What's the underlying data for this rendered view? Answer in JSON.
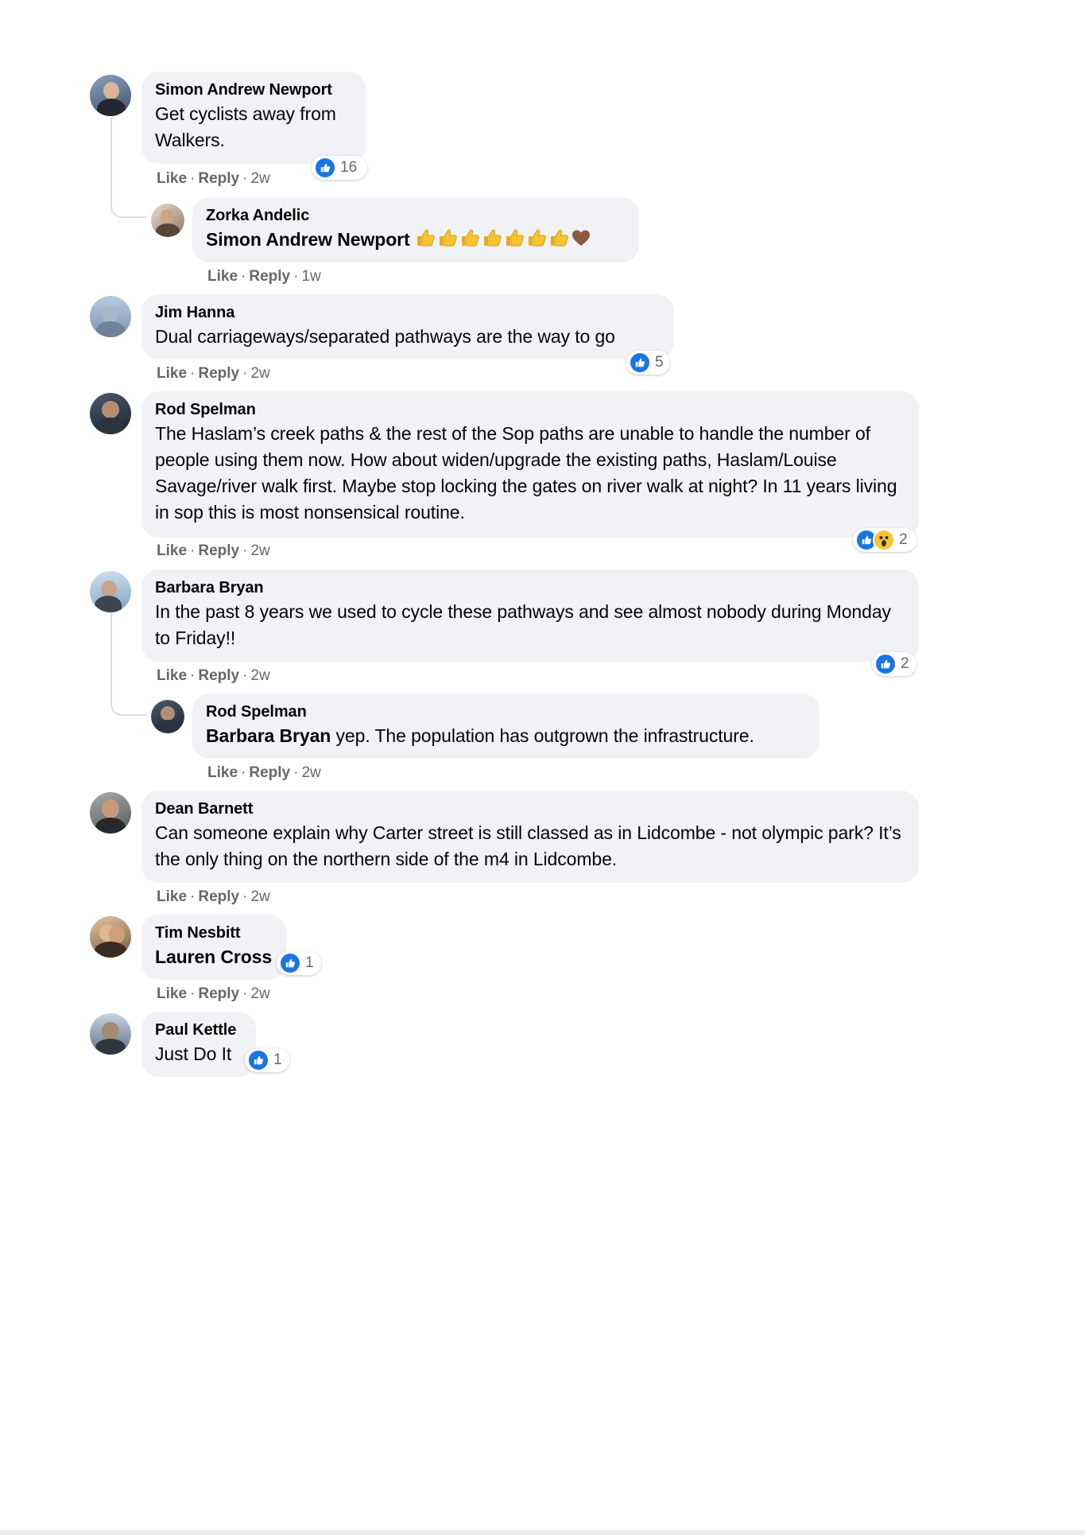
{
  "actions": {
    "like": "Like",
    "reply": "Reply",
    "sep": "·"
  },
  "colors": {
    "bubble": "#f0f2f5",
    "like_blue": "#1b74e4",
    "meta_gray": "#65676b"
  },
  "comments": [
    {
      "author": "Simon Andrew Newport",
      "text_line1": "Get cyclists away from",
      "text_line2": "Walkers.",
      "time": "2w",
      "reactions": {
        "icons": [
          "like-icon"
        ],
        "count": "16"
      },
      "replies": [
        {
          "author": "Zorka Andelic",
          "mention": "Simon Andrew Newport",
          "emoji": [
            "thumbs-up-icon",
            "thumbs-up-icon",
            "thumbs-up-icon",
            "thumbs-up-icon",
            "thumbs-up-icon",
            "thumbs-up-icon",
            "thumbs-up-icon",
            "brown-heart-icon"
          ],
          "time": "1w"
        }
      ]
    },
    {
      "author": "Jim Hanna",
      "text": "Dual carriageways/separated pathways are the way to go",
      "time": "2w",
      "reactions": {
        "icons": [
          "like-icon"
        ],
        "count": "5"
      }
    },
    {
      "author": "Rod Spelman",
      "text": "The Haslam’s creek paths & the rest of the Sop paths are unable to handle the number of people using them now. How about widen/upgrade the existing paths, Haslam/Louise Savage/river walk first. Maybe stop locking the gates on river walk at night? In 11 years living in sop this is most nonsensical routine.",
      "time": "2w",
      "reactions": {
        "icons": [
          "like-icon",
          "wow-icon"
        ],
        "count": "2"
      }
    },
    {
      "author": "Barbara Bryan",
      "text": "In the past 8 years we used to cycle these pathways and see almost nobody during Monday to Friday!!",
      "time": "2w",
      "reactions": {
        "icons": [
          "like-icon"
        ],
        "count": "2"
      },
      "replies": [
        {
          "author": "Rod Spelman",
          "mention": "Barbara Bryan",
          "text": " yep. The population has outgrown the infrastructure.",
          "time": "2w"
        }
      ]
    },
    {
      "author": "Dean Barnett",
      "text": "Can someone explain why Carter street is still classed as in Lidcombe - not olympic park? It’s the only thing on the northern side of the m4 in Lidcombe.",
      "time": "2w"
    },
    {
      "author": "Tim Nesbitt",
      "mention": "Lauren Cross",
      "time": "2w",
      "reactions": {
        "icons": [
          "like-icon"
        ],
        "count": "1"
      }
    },
    {
      "author": "Paul Kettle",
      "text": "Just Do It",
      "reactions": {
        "icons": [
          "like-icon"
        ],
        "count": "1"
      }
    }
  ]
}
